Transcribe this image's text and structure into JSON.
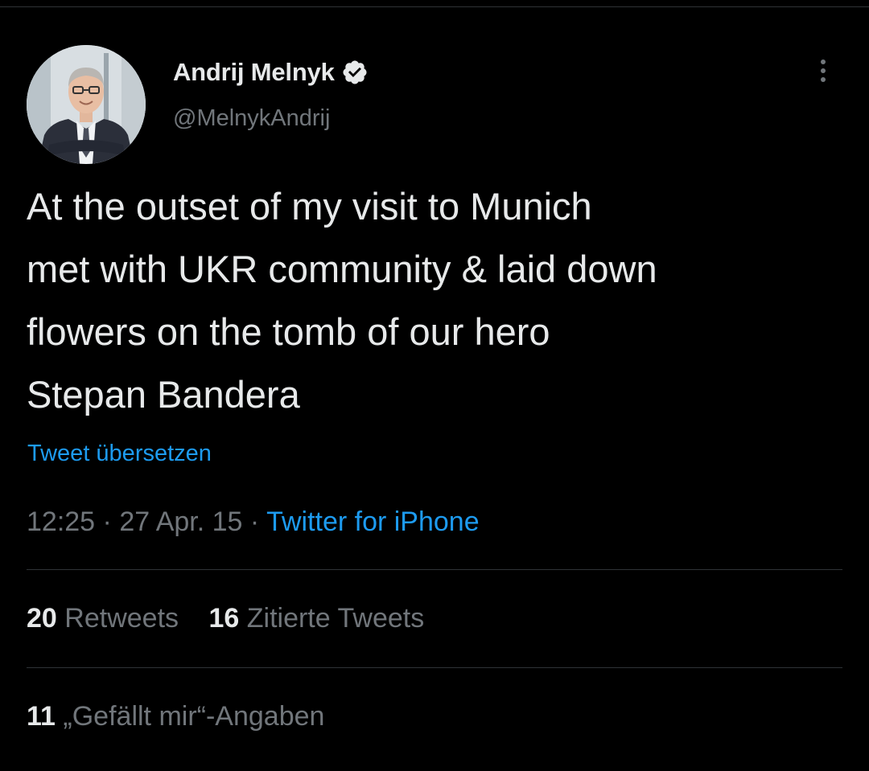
{
  "author": {
    "display_name": "Andrij Melnyk",
    "handle": "@MelnykAndrij",
    "verified": true,
    "avatar": "profile-photo-man-in-suit"
  },
  "tweet": {
    "text": "At the outset of my visit to Munich\nmet with UKR community & laid down\nflowers on the tomb of our hero\nStepan Bandera",
    "translate_label": "Tweet übersetzen"
  },
  "meta": {
    "time": "12:25",
    "separator1": " · ",
    "date": "27 Apr. 15",
    "separator2": " · ",
    "source": "Twitter for iPhone"
  },
  "stats": {
    "retweets_count": "20",
    "retweets_label": "Retweets",
    "quotes_count": "16",
    "quotes_label": "Zitierte Tweets",
    "likes_count": "11",
    "likes_label": "„Gefällt mir“-Angaben"
  },
  "colors": {
    "background": "#000000",
    "text_primary": "#e7e9ea",
    "text_secondary": "#71767b",
    "accent": "#1d9bf0",
    "divider": "#2f3336"
  },
  "icons": {
    "verified": "verified-badge-icon",
    "more": "more-options-icon"
  }
}
